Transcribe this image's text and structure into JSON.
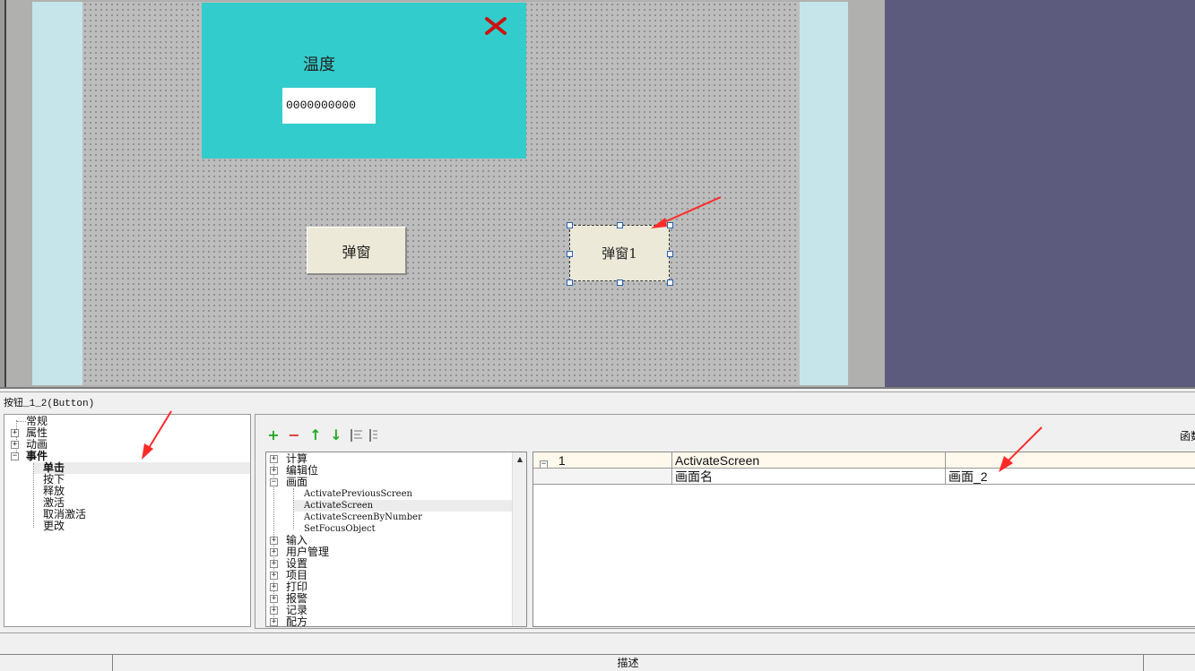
{
  "screen": {
    "popup": {
      "title": "温度",
      "value": "0000000000"
    },
    "buttons": {
      "popup": "弹窗",
      "popup1": "弹窗1"
    }
  },
  "properties": {
    "title": "按钮_1_2(Button)",
    "categories": [
      {
        "label": "常规"
      },
      {
        "label": "属性"
      },
      {
        "label": "动画"
      },
      {
        "label": "事件"
      }
    ],
    "events": [
      {
        "label": "单击"
      },
      {
        "label": "按下"
      },
      {
        "label": "释放"
      },
      {
        "label": "激活"
      },
      {
        "label": "取消激活"
      },
      {
        "label": "更改"
      }
    ],
    "toolbar": {
      "func_label": "函数"
    },
    "functions": {
      "before": [
        {
          "label": "计算"
        },
        {
          "label": "编辑位"
        }
      ],
      "screen_group": "画面",
      "screen_children": [
        {
          "label": "ActivatePreviousScreen"
        },
        {
          "label": "ActivateScreen"
        },
        {
          "label": "ActivateScreenByNumber"
        },
        {
          "label": "SetFocusObject"
        }
      ],
      "after": [
        {
          "label": "输入"
        },
        {
          "label": "用户管理"
        },
        {
          "label": "设置"
        },
        {
          "label": "项目"
        },
        {
          "label": "打印"
        },
        {
          "label": "报警"
        },
        {
          "label": "记录"
        },
        {
          "label": "配方"
        }
      ]
    },
    "grid": {
      "row1": {
        "index": "1",
        "function": "ActivateScreen"
      },
      "row2": {
        "param": "画面名",
        "value": "画面_2"
      }
    }
  },
  "status_bar": {
    "description": "描述"
  },
  "colors": {
    "popup": "#33cccc",
    "right_panel": "#5c5b7e",
    "arrow": "#ff2a2a"
  }
}
